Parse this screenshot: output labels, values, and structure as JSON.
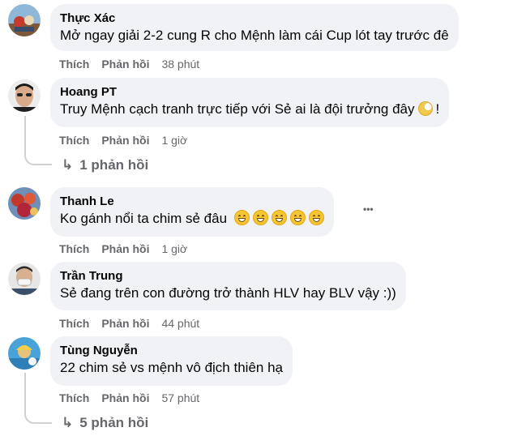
{
  "comments": [
    {
      "author": "Thực Xác",
      "text": "Mở ngay giải 2-2 cung R cho Mệnh làm cái Cup lót tay trước đê",
      "like": "Thích",
      "reply": "Phản hồi",
      "time": "38 phút"
    },
    {
      "author": "Hoang PT",
      "text": "Truy Mệnh cạch tranh trực tiếp với Sẻ ai là đội trưởng đây",
      "text_suffix": "!",
      "like": "Thích",
      "reply": "Phản hồi",
      "time": "1 giờ",
      "replies": "1 phản hồi"
    },
    {
      "author": "Thanh Le",
      "text": "Ko gánh nổi ta chim sẻ đâu",
      "like": "Thích",
      "reply": "Phản hồi",
      "time": "1 giờ",
      "more": "•••"
    },
    {
      "author": "Trần Trung",
      "text": "Sẻ đang trên con đường trở thành HLV hay BLV vậy :))",
      "like": "Thích",
      "reply": "Phản hồi",
      "time": "44 phút"
    },
    {
      "author": "Tùng Nguyễn",
      "text": "22 chim sẻ vs mệnh vô địch thiên hạ",
      "like": "Thích",
      "reply": "Phản hồi",
      "time": "57 phút",
      "replies": "5 phản hồi"
    }
  ],
  "icons": {
    "reply_arrow": "↳",
    "grin_emoji": "grinning-face-icon",
    "moon_emoji": "moon-face-icon"
  },
  "colors": {
    "bubble": "#f0f2f5",
    "meta_text": "#65676b",
    "thread_line": "#ced0d4"
  }
}
